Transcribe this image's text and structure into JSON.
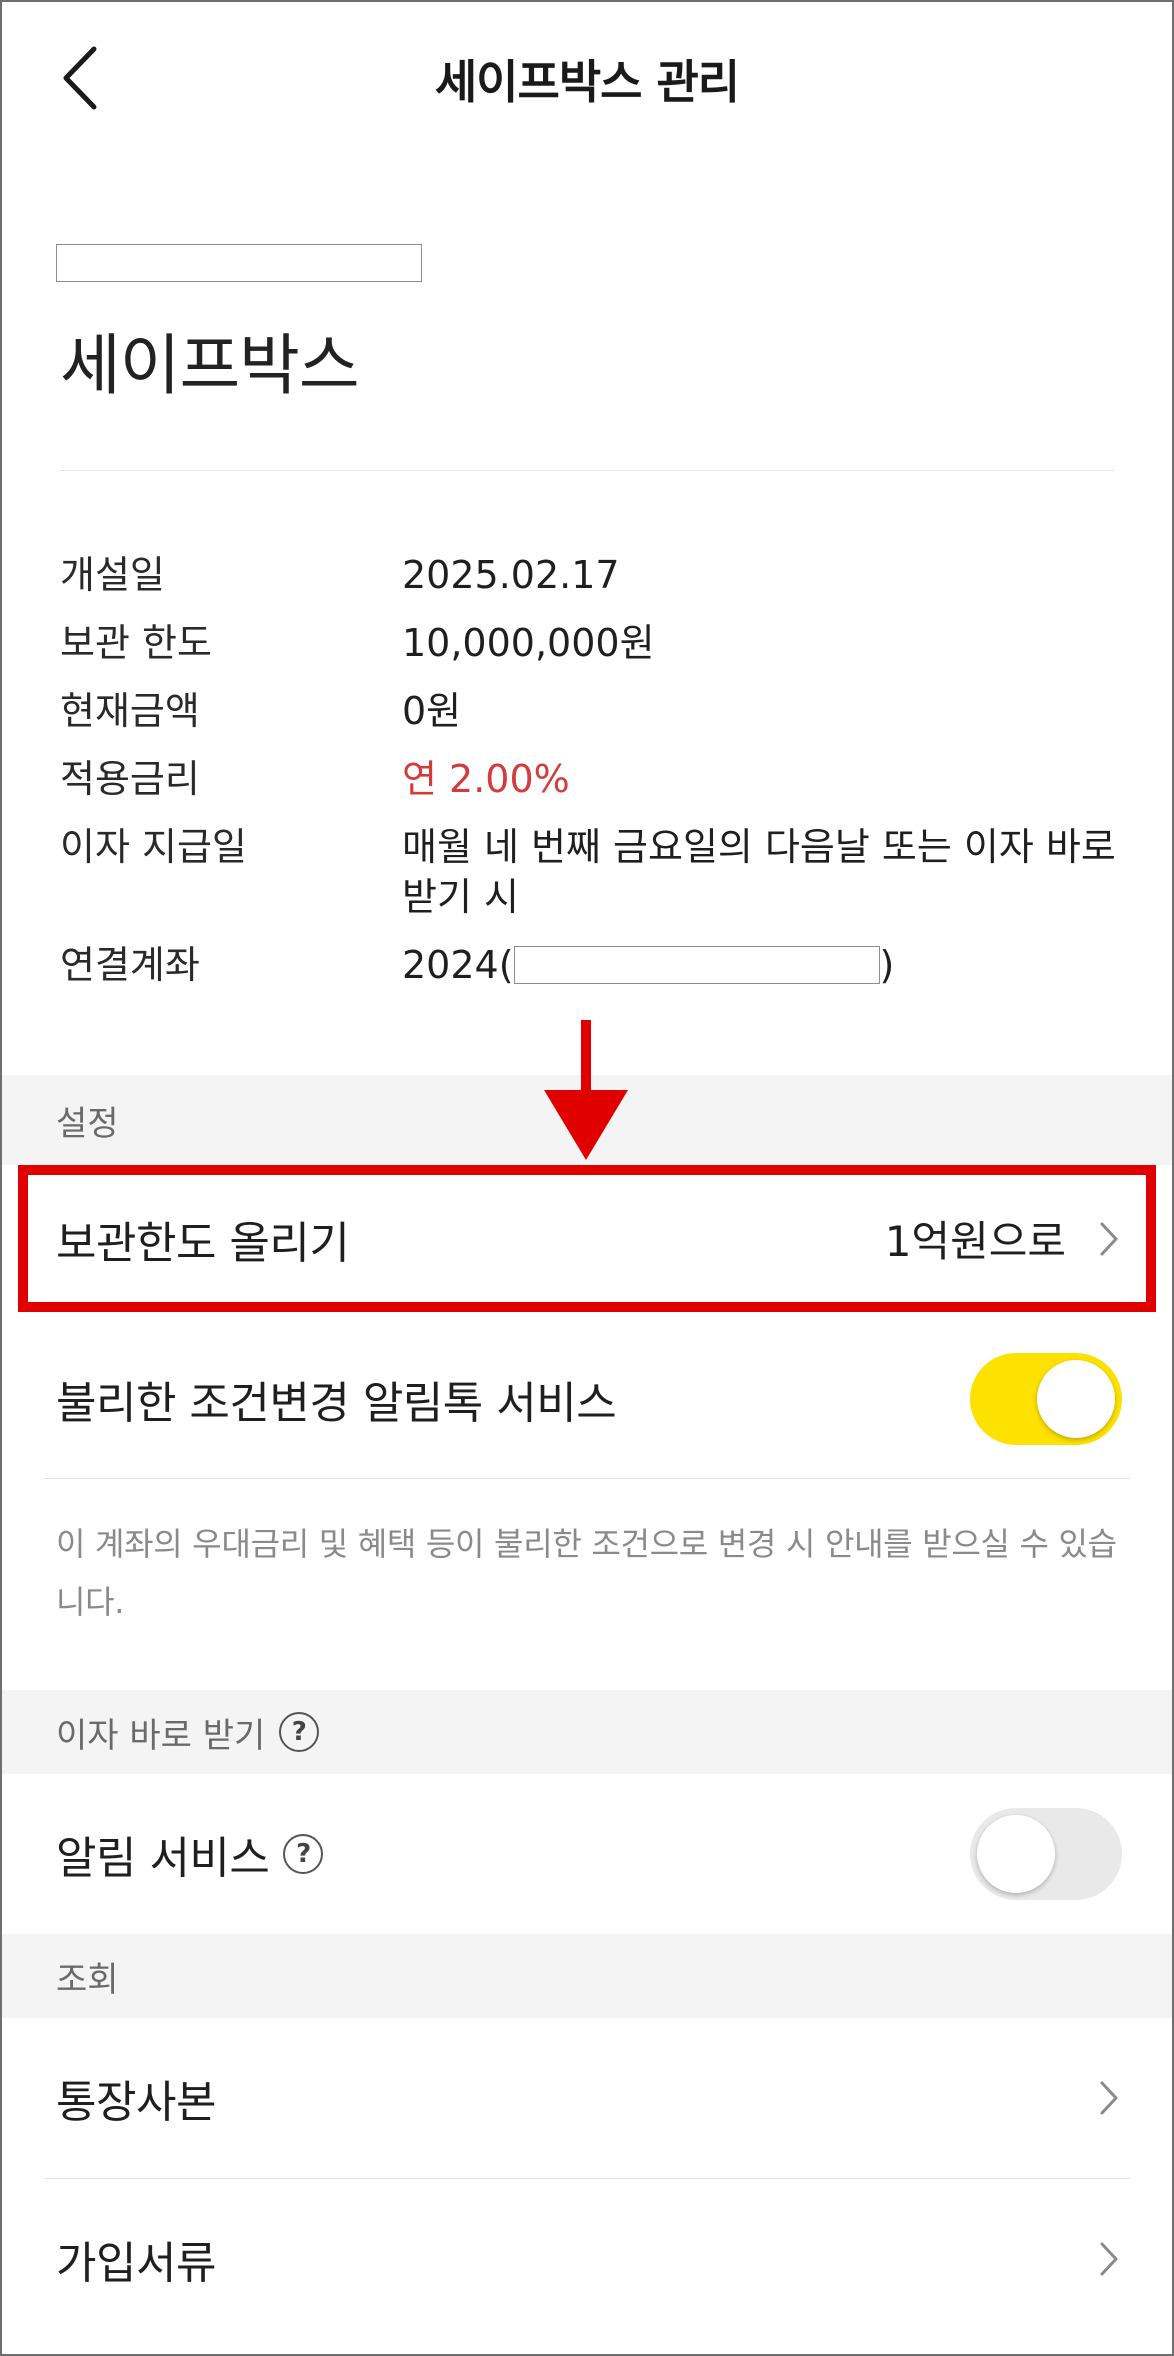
{
  "header": {
    "title": "세이프박스 관리"
  },
  "account": {
    "name": "세이프박스"
  },
  "info": [
    {
      "label": "개설일",
      "value": "2025.02.17"
    },
    {
      "label": "보관 한도",
      "value": "10,000,000원"
    },
    {
      "label": "현재금액",
      "value": "0원"
    },
    {
      "label": "적용금리",
      "value": "연 2.00%"
    },
    {
      "label": "이자 지급일",
      "value": "매월 네 번째 금요일의 다음날 또는 이자 바로 받기 시"
    },
    {
      "label": "연결계좌",
      "value_prefix": "2024(",
      "value_suffix": ")"
    }
  ],
  "sections": {
    "settings": "설정",
    "interest_now": "이자 바로 받기",
    "inquiry": "조회"
  },
  "settings": {
    "raise_limit": {
      "label": "보관한도 올리기",
      "value": "1억원으로"
    },
    "alert_talk": {
      "label": "불리한 조건변경 알림톡 서비스",
      "enabled": true
    },
    "note": "이 계좌의 우대금리 및 혜택 등이 불리한 조건으로 변경 시 안내를 받으실 수 있습니다."
  },
  "interest_now": {
    "alert_service": {
      "label": "알림 서비스",
      "enabled": false
    }
  },
  "inquiry": {
    "items": [
      {
        "label": "통장사본"
      },
      {
        "label": "가입서류"
      }
    ]
  },
  "icons": {
    "back": "chevron-left-icon",
    "help": "question-circle-icon",
    "chevron": "chevron-right-icon",
    "help_glyph": "?"
  },
  "colors": {
    "accent_toggle": "#fde100",
    "rate_red": "#d43b3b",
    "highlight": "#e00000",
    "section_bg": "#f4f4f4"
  }
}
